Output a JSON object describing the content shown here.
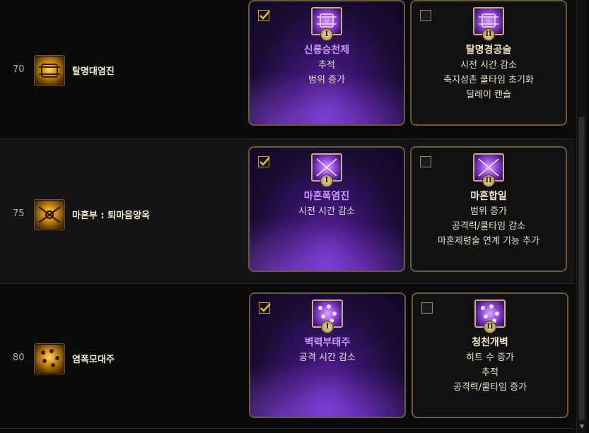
{
  "rows": [
    {
      "level": "70",
      "skill": "탈명대염진",
      "options": [
        {
          "title": "신룡승천제",
          "numeral": "I",
          "selected": true,
          "lines": [
            "추적",
            "범위 증가"
          ]
        },
        {
          "title": "탈명경공술",
          "numeral": "II",
          "selected": false,
          "lines": [
            "시전 시간 감소",
            "축지성촌 쿨타임 초기화",
            "딜레이 캔슬"
          ]
        }
      ]
    },
    {
      "level": "75",
      "skill": "마혼부 : 퇴마음양옥",
      "options": [
        {
          "title": "마혼폭염진",
          "numeral": "I",
          "selected": true,
          "lines": [
            "시전 시간 감소"
          ]
        },
        {
          "title": "마혼합일",
          "numeral": "II",
          "selected": false,
          "lines": [
            "범위 증가",
            "공격력/쿨타임 감소",
            "마혼제령술 연계 기능 추가"
          ]
        }
      ]
    },
    {
      "level": "80",
      "skill": "염폭모대주",
      "options": [
        {
          "title": "벽력부태주",
          "numeral": "I",
          "selected": true,
          "lines": [
            "공격 시간 감소"
          ]
        },
        {
          "title": "청천개벽",
          "numeral": "II",
          "selected": false,
          "lines": [
            "히트 수 증가",
            "추적",
            "공격력/쿨타임 증가"
          ]
        }
      ]
    }
  ],
  "colors": {
    "selected_title": "#c996ff",
    "gold_border": "#6b5a3c"
  }
}
